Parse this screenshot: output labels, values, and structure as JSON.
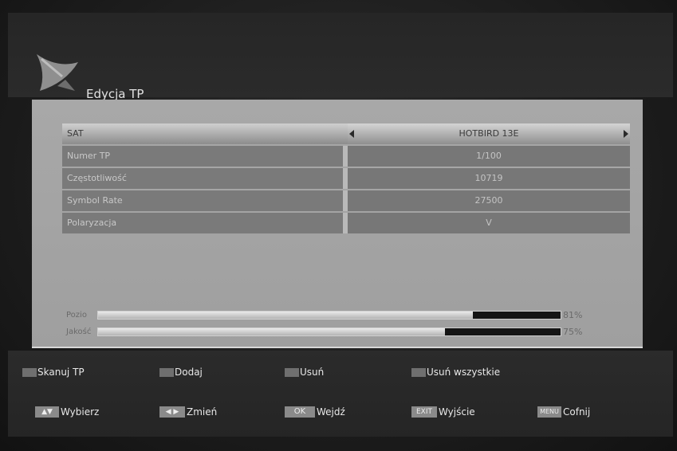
{
  "header": {
    "title": "Edycja TP",
    "logo_icon": "satellite-dish-icon"
  },
  "table": {
    "rows": [
      {
        "label": "SAT",
        "value": "HOTBIRD 13E"
      },
      {
        "label": "Numer TP",
        "value": "1/100"
      },
      {
        "label": "Częstotliwość",
        "value": "10719"
      },
      {
        "label": "Symbol Rate",
        "value": "27500"
      },
      {
        "label": "Polaryzacja",
        "value": "V"
      }
    ]
  },
  "signal": {
    "level": {
      "label": "Pozio",
      "value_text": "81%",
      "value": 81
    },
    "quality": {
      "label": "Jakość",
      "value_text": "75%",
      "value": 75
    }
  },
  "footer": {
    "actions": [
      {
        "label": "Skanuj TP",
        "color": "#6f6f6f"
      },
      {
        "label": "Dodaj",
        "color": "#6f6f6f"
      },
      {
        "label": "Usuń",
        "color": "#6f6f6f"
      },
      {
        "label": "Usuń wszystkie",
        "color": "#6f6f6f"
      }
    ],
    "keys": [
      {
        "key": "▲▼",
        "label": "Wybierz"
      },
      {
        "key": "◀ ▶",
        "label": "Zmień"
      },
      {
        "key": "OK",
        "label": "Wejdź"
      },
      {
        "key": "EXIT",
        "label": "Wyjście"
      },
      {
        "key": "MENU",
        "label": "Cofnij"
      }
    ]
  }
}
